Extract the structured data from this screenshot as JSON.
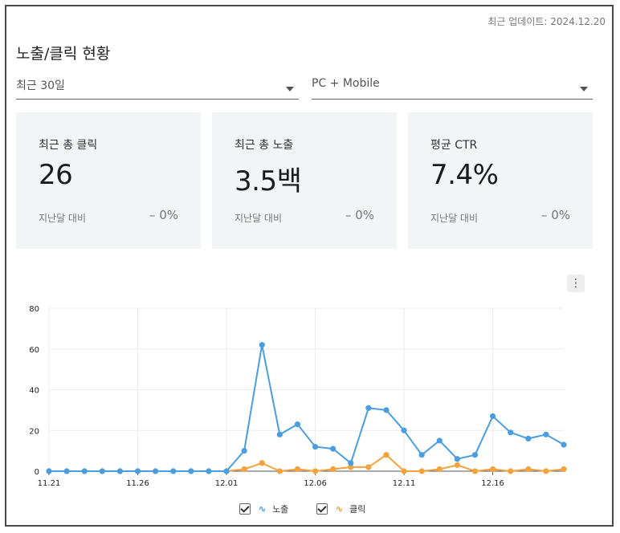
{
  "header": {
    "updated": "최근 업데이트: 2024.12.20",
    "title": "노출/클릭 현황"
  },
  "filters": {
    "period": "최근 30일",
    "device": "PC + Mobile"
  },
  "cards": [
    {
      "label": "최근 총 클릭",
      "value": "26",
      "compare_label": "지난달 대비",
      "change": "– 0%"
    },
    {
      "label": "최근 총 노출",
      "value": "3.5백",
      "compare_label": "지난달 대비",
      "change": "– 0%"
    },
    {
      "label": "평균 CTR",
      "value": "7.4%",
      "compare_label": "지난달 대비",
      "change": "– 0%"
    }
  ],
  "menu": {
    "icon": "kebab-menu-icon",
    "label": "⋮"
  },
  "legend": [
    {
      "name": "노출",
      "color": "#4a9ee0",
      "checked": true
    },
    {
      "name": "클릭",
      "color": "#f5a23c",
      "checked": true
    }
  ],
  "chart_data": {
    "type": "line",
    "x": [
      "11.21",
      "11.22",
      "11.23",
      "11.24",
      "11.25",
      "11.26",
      "11.27",
      "11.28",
      "11.29",
      "11.30",
      "12.01",
      "12.02",
      "12.03",
      "12.04",
      "12.05",
      "12.06",
      "12.07",
      "12.08",
      "12.09",
      "12.10",
      "12.11",
      "12.12",
      "12.13",
      "12.14",
      "12.15",
      "12.16",
      "12.17",
      "12.18",
      "12.19",
      "12.20"
    ],
    "xticks": [
      "11.21",
      "11.26",
      "12.01",
      "12.06",
      "12.11",
      "12.16"
    ],
    "yticks": [
      0,
      20,
      40,
      60,
      80
    ],
    "ylim": [
      0,
      80
    ],
    "grid": true,
    "series": [
      {
        "name": "노출",
        "color": "#4a9ee0",
        "values": [
          0,
          0,
          0,
          0,
          0,
          0,
          0,
          0,
          0,
          0,
          0,
          10,
          62,
          18,
          23,
          12,
          11,
          4,
          31,
          30,
          20,
          8,
          15,
          6,
          8,
          27,
          19,
          16,
          18,
          13
        ]
      },
      {
        "name": "클릭",
        "color": "#f5a23c",
        "values": [
          0,
          0,
          0,
          0,
          0,
          0,
          0,
          0,
          0,
          0,
          0,
          1,
          4,
          0,
          1,
          0,
          1,
          2,
          2,
          8,
          0,
          0,
          1,
          3,
          0,
          1,
          0,
          1,
          0,
          1
        ]
      }
    ]
  }
}
